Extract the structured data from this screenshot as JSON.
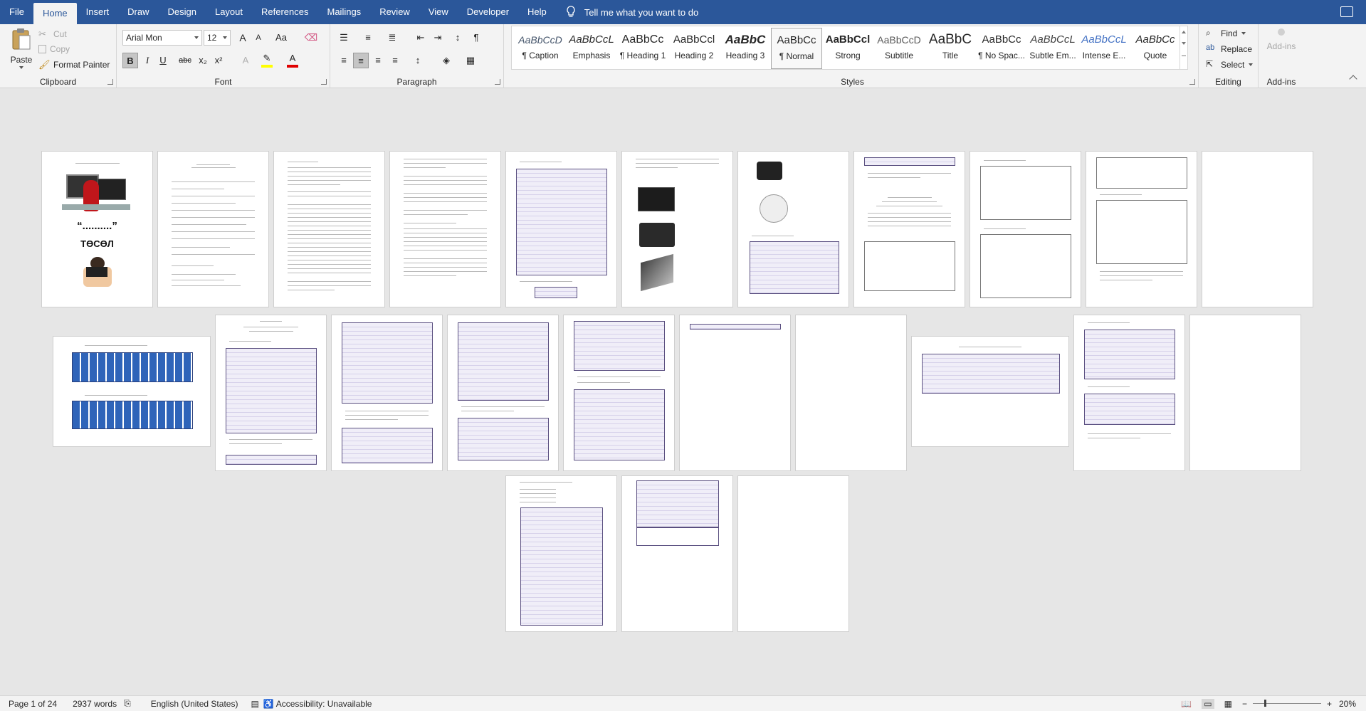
{
  "tabs": [
    "File",
    "Home",
    "Insert",
    "Draw",
    "Design",
    "Layout",
    "References",
    "Mailings",
    "Review",
    "View",
    "Developer",
    "Help"
  ],
  "active_tab": "Home",
  "tell_me": "Tell me what you want to do",
  "clipboard": {
    "paste": "Paste",
    "cut": "Cut",
    "copy": "Copy",
    "format_painter": "Format Painter",
    "label": "Clipboard"
  },
  "font": {
    "name": "Arial Mon",
    "size": "12",
    "label": "Font",
    "bold": "B",
    "italic": "I",
    "underline": "U",
    "strike": "abc",
    "sub": "x₂",
    "sup": "x²",
    "grow": "A",
    "shrink": "A",
    "case": "Aa",
    "colors": {
      "highlight": "#ffff00",
      "font_color": "#e00000"
    }
  },
  "paragraph": {
    "label": "Paragraph"
  },
  "styles": {
    "label": "Styles",
    "items": [
      {
        "preview": "AaBbCcD",
        "name": "¶ Caption"
      },
      {
        "preview": "AaBbCcL",
        "name": "Emphasis"
      },
      {
        "preview": "AaBbCc",
        "name": "¶ Heading 1"
      },
      {
        "preview": "AaBbCcl",
        "name": "Heading 2"
      },
      {
        "preview": "AaBbC",
        "name": "Heading 3"
      },
      {
        "preview": "AaBbCc",
        "name": "¶ Normal"
      },
      {
        "preview": "AaBbCcl",
        "name": "Strong"
      },
      {
        "preview": "AaBbCcD",
        "name": "Subtitle"
      },
      {
        "preview": "AaBbC",
        "name": "Title"
      },
      {
        "preview": "AaBbCc",
        "name": "¶ No Spac..."
      },
      {
        "preview": "AaBbCcL",
        "name": "Subtle Em..."
      },
      {
        "preview": "AaBbCcL",
        "name": "Intense E..."
      },
      {
        "preview": "AaBbCc",
        "name": "Quote"
      }
    ],
    "selected": "¶ Normal"
  },
  "editing": {
    "find": "Find",
    "replace": "Replace",
    "select": "Select",
    "label": "Editing"
  },
  "addins": {
    "button": "Add-ins",
    "label": "Add-ins"
  },
  "cover": {
    "title": "“..........”",
    "subtitle": "ТӨСӨЛ"
  },
  "status": {
    "page": "Page 1 of 24",
    "words": "2937 words",
    "language": "English (United States)",
    "accessibility": "Accessibility: Unavailable",
    "zoom": "20%"
  }
}
